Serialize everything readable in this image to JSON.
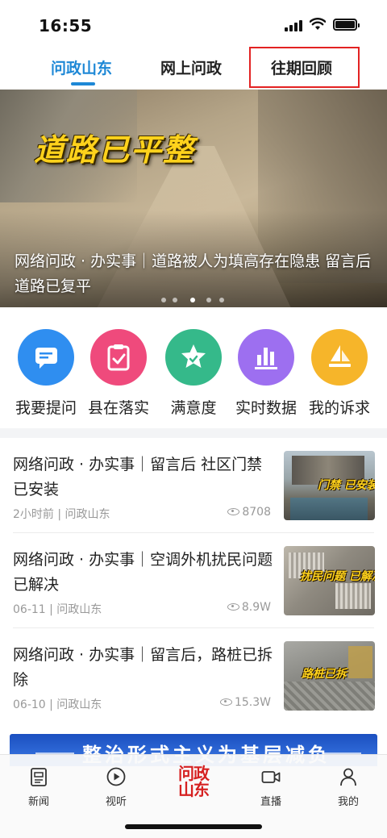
{
  "status_bar": {
    "time": "16:55"
  },
  "tabs": [
    {
      "label": "问政山东",
      "active": true
    },
    {
      "label": "网上问政",
      "active": false
    },
    {
      "label": "往期回顾",
      "active": false
    }
  ],
  "banner": {
    "headline": "道路已平整",
    "caption": "网络问政 · 办实事｜道路被人为填高存在隐患 留言后道路已复平",
    "dots_count": 5,
    "active_dot": 3
  },
  "quick_actions": [
    {
      "label": "我要提问",
      "icon": "chat-bubble-icon",
      "color": "#2f8ef0"
    },
    {
      "label": "县在落实",
      "icon": "clipboard-check-icon",
      "color": "#ef4a7c"
    },
    {
      "label": "满意度",
      "icon": "star-icon",
      "color": "#35b98a"
    },
    {
      "label": "实时数据",
      "icon": "bar-chart-icon",
      "color": "#9d6ff0"
    },
    {
      "label": "我的诉求",
      "icon": "paper-plane-icon",
      "color": "#f6b52a"
    }
  ],
  "news": [
    {
      "title": "网络问政 · 办实事｜留言后 社区门禁已安装",
      "meta": "2小时前 | 问政山东",
      "views": "8708",
      "thumb_label": "门禁 已安装"
    },
    {
      "title": "网络问政 · 办实事｜空调外机扰民问题已解决",
      "meta": "06-11 | 问政山东",
      "views": "8.9W",
      "thumb_label": "扰民问题 已解决"
    },
    {
      "title": "网络问政 · 办实事｜留言后，路桩已拆除",
      "meta": "06-10 | 问政山东",
      "views": "15.3W",
      "thumb_label": "路桩已拆"
    }
  ],
  "promo": {
    "text": "整治形式主义为基层减负"
  },
  "tabbar": [
    {
      "label": "新闻",
      "icon": "news-icon"
    },
    {
      "label": "视听",
      "icon": "play-icon"
    },
    {
      "label": "问政山东",
      "icon": "wenzheng-logo"
    },
    {
      "label": "直播",
      "icon": "video-camera-icon"
    },
    {
      "label": "我的",
      "icon": "person-icon"
    }
  ]
}
